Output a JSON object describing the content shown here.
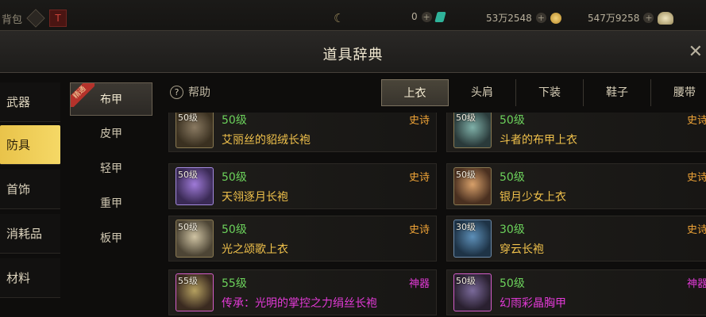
{
  "topbar": {
    "bag_label": "背包",
    "rank_badge": "T",
    "res_a": "0",
    "res_b": "53万2548",
    "res_c": "547万9258"
  },
  "window": {
    "title": "道具辞典",
    "close": "✕"
  },
  "categories": [
    {
      "label": "武器"
    },
    {
      "label": "防具"
    },
    {
      "label": "首饰"
    },
    {
      "label": "消耗品"
    },
    {
      "label": "材料"
    }
  ],
  "subcategories": [
    {
      "label": "布甲",
      "ribbon": "精通"
    },
    {
      "label": "皮甲"
    },
    {
      "label": "轻甲"
    },
    {
      "label": "重甲"
    },
    {
      "label": "板甲"
    }
  ],
  "help": {
    "label": "帮助"
  },
  "tabs": [
    {
      "label": "上衣"
    },
    {
      "label": "头肩"
    },
    {
      "label": "下装"
    },
    {
      "label": "鞋子"
    },
    {
      "label": "腰带"
    }
  ],
  "items": [
    {
      "lv_tag": "50级",
      "level": "50级",
      "name": "艾丽丝的貂绒长袍",
      "rarity": "史诗",
      "icon": "robe-icon"
    },
    {
      "lv_tag": "50级",
      "level": "50级",
      "name": "斗者的布甲上衣",
      "rarity": "史诗",
      "icon": "armor-icon"
    },
    {
      "lv_tag": "50级",
      "level": "50级",
      "name": "天翎逐月长袍",
      "rarity": "史诗",
      "icon": "robe-icon"
    },
    {
      "lv_tag": "50级",
      "level": "50级",
      "name": "银月少女上衣",
      "rarity": "史诗",
      "icon": "coat-icon"
    },
    {
      "lv_tag": "50级",
      "level": "50级",
      "name": "光之颂歌上衣",
      "rarity": "史诗",
      "icon": "scroll-icon"
    },
    {
      "lv_tag": "30级",
      "level": "30级",
      "name": "穿云长袍",
      "rarity": "史诗",
      "icon": "robe-icon"
    },
    {
      "lv_tag": "55级",
      "level": "55级",
      "name": "传承：光明的掌控之力绢丝长袍",
      "rarity": "神器",
      "icon": "robe-icon"
    },
    {
      "lv_tag": "50级",
      "level": "50级",
      "name": "幻雨彩晶胸甲",
      "rarity": "神器",
      "icon": "breastplate-icon"
    }
  ],
  "colors": {
    "accent_gold": "#f0c14b",
    "epic_orange": "#f0a437",
    "artifact_magenta": "#e23ad6",
    "level_green": "#6cd25b",
    "active_category": "#f5d866"
  }
}
